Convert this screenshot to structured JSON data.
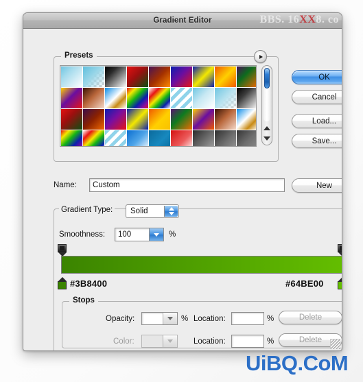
{
  "window": {
    "title": "Gradient Editor",
    "watermark_top_prefix": "BBS. 16",
    "watermark_top_red": "XX",
    "watermark_top_suffix": "8. co",
    "watermark_bottom": "UiBQ.CoM"
  },
  "presets": {
    "legend": "Presets",
    "options_icon": "options-triangle-icon",
    "scrollbar": {
      "up_icon": "triangle-up-icon",
      "down_icon": "triangle-down-icon"
    },
    "swatches": [
      {
        "name": "transparent-blue",
        "css": "linear-gradient(135deg,#6fc6e2 0%,#a9dced 35%,#ffffff 100%)"
      },
      {
        "name": "blue-to-checker",
        "css": "linear-gradient(135deg,#5fbfdd 0%,#9ad6e8 45%,rgba(255,255,255,0) 100%)"
      },
      {
        "name": "black-white",
        "css": "linear-gradient(135deg,#000000 0%,#2b2b2b 30%,#ffffff 100%)"
      },
      {
        "name": "red-green",
        "css": "linear-gradient(135deg,#e41212 0%,#9c0f0f 45%,#0b4f12 100%)"
      },
      {
        "name": "violet-orange",
        "css": "linear-gradient(135deg,#4a1455 0%,#a33000 50%,#ff8a00 100%)"
      },
      {
        "name": "blue-red",
        "css": "linear-gradient(135deg,#0b1fae 0%,#6a0ea0 45%,#e81414 100%)"
      },
      {
        "name": "blue-yellow-blue",
        "css": "linear-gradient(135deg,#0b1fae 0%,#f3e800 50%,#0b1fae 100%)"
      },
      {
        "name": "orange-yellow",
        "css": "linear-gradient(135deg,#f05a00 0%,#ffd000 50%,#f05a00 100%)"
      },
      {
        "name": "violet-green-orange",
        "css": "linear-gradient(135deg,#4a1455 0%,#0d6b1e 40%,#f26a00 100%)"
      },
      {
        "name": "yellow-violet-red",
        "css": "linear-gradient(135deg,#ffd000 0%,#6a0ea0 45%,#e81414 100%)"
      },
      {
        "name": "copper",
        "css": "linear-gradient(135deg,#3a1406 0%,#b9663a 45%,#f4d8c8 100%)"
      },
      {
        "name": "blue-gold-white",
        "css": "linear-gradient(135deg,#0b8ce8 0%,#ffffff 48%,#c88a14 70%,#ffffff 100%)"
      },
      {
        "name": "spectrum",
        "css": "linear-gradient(135deg,#e81414 0%,#f3e800 22%,#16b415 44%,#0b1fae 66%,#8a0ea0 85%,#e81414 100%)"
      },
      {
        "name": "transparent-rainbow",
        "css": "linear-gradient(135deg,#ffffff 0%,#e81414 25%,#f3e800 45%,#16b415 62%,#0b1fae 80%,#ffffff 100%)"
      },
      {
        "name": "blue-stripes",
        "css": "repeating-linear-gradient(135deg,#8fd3ea 0 5px,#ffffff 5px 10px)"
      },
      {
        "name": "pale-blue-white",
        "css": "linear-gradient(135deg,#6fc6e2 0%,#c7e8f3 45%,#ffffff 100%)"
      },
      {
        "name": "blue-checker",
        "css": "linear-gradient(135deg,#6fc6e2 0%,#b8e2ef 50%,rgba(255,255,255,0) 100%)"
      },
      {
        "name": "black-white-2",
        "css": "linear-gradient(135deg,#000000 0%,#3c3c3c 35%,#ffffff 100%)"
      },
      {
        "name": "red-dark-green",
        "css": "linear-gradient(135deg,#e41212 0%,#9c0f0f 40%,#0b4f12 100%)"
      },
      {
        "name": "purple-orange",
        "css": "linear-gradient(135deg,#3a0d4a 0%,#8c2200 50%,#f26a00 100%)"
      },
      {
        "name": "blue-red-2",
        "css": "linear-gradient(135deg,#0b1fae 0%,#7a0ea0 45%,#e81414 100%)"
      },
      {
        "name": "blue-yellow-blue-2",
        "css": "linear-gradient(135deg,#0b1fae 0%,#f3e800 50%,#0b1fae 100%)"
      },
      {
        "name": "orange-yellow-2",
        "css": "linear-gradient(135deg,#f05a00 0%,#ffd000 55%,#f8c100 100%)"
      },
      {
        "name": "violet-green-orange-2",
        "css": "linear-gradient(135deg,#5a1470 0%,#0d7b20 42%,#f26a00 100%)"
      },
      {
        "name": "yellow-violet-red-2",
        "css": "linear-gradient(135deg,#ffd000 0%,#6a0ea0 48%,#f05a00 100%)"
      },
      {
        "name": "copper-2",
        "css": "linear-gradient(135deg,#3a1406 0%,#b9663a 45%,#f4d8c8 100%)"
      },
      {
        "name": "blue-gold-white-2",
        "css": "linear-gradient(135deg,#0b8ce8 0%,#ffffff 45%,#c88a14 72%,#ffffff 100%)"
      },
      {
        "name": "spectrum-2",
        "css": "linear-gradient(135deg,#e81414 0%,#f3e800 20%,#16b415 42%,#0b1fae 66%,#8a0ea0 88%,#e81414 100%)"
      },
      {
        "name": "transparent-rainbow-2",
        "css": "linear-gradient(135deg,#ffffff 0%,#e81414 22%,#f3e800 42%,#16b415 60%,#0b1fae 82%,#ffffff 100%)"
      },
      {
        "name": "blue-stripes-2",
        "css": "repeating-linear-gradient(135deg,#8fd3ea 0 5px,#ffffff 5px 10px)"
      },
      {
        "name": "blue-to-white",
        "css": "linear-gradient(135deg,#0b6fd0 0%,#4fa5e8 50%,#ffffff 100%)"
      },
      {
        "name": "steel-blue",
        "css": "linear-gradient(135deg,#0b6a9c 0%,#1788be 55%,#0b6a9c 100%)"
      },
      {
        "name": "red-to-white",
        "css": "linear-gradient(135deg,#d41212 0%,#ec5a5a 55%,#ffffff 100%)"
      },
      {
        "name": "gray-gradient",
        "css": "linear-gradient(135deg,#2c2c2c 0%,#6a6a6a 50%,#a8a8a8 100%)"
      },
      {
        "name": "gray-gradient-2",
        "css": "linear-gradient(135deg,#303030 0%,#707070 55%,#9a9a9a 100%)"
      },
      {
        "name": "gray-gradient-3",
        "css": "linear-gradient(135deg,#353535 0%,#6d6d6d 50%,#8f8f8f 100%)"
      }
    ]
  },
  "buttons": {
    "ok": "OK",
    "cancel": "Cancel",
    "load": "Load...",
    "save": "Save...",
    "new": "New",
    "delete_1": "Delete",
    "delete_2": "Delete"
  },
  "name_row": {
    "label": "Name:",
    "value": "Custom"
  },
  "gradient_type": {
    "label": "Gradient Type:",
    "value": "Solid",
    "stepper_icon": "stepper-updown-icon"
  },
  "smoothness": {
    "label": "Smoothness:",
    "value": "100",
    "percent": "%",
    "dropdown_icon": "chevron-down-icon"
  },
  "gradient": {
    "start_hex": "#3B8400",
    "end_hex": "#64BE00",
    "css": "linear-gradient(to right,#3B8400 0%,#4e9e00 45%,#64BE00 100%)",
    "opacity_stop_left_name": "opacity-stop-left",
    "opacity_stop_right_name": "opacity-stop-right",
    "color_stop_left_name": "color-stop-left",
    "color_stop_right_name": "color-stop-right"
  },
  "stops": {
    "legend": "Stops",
    "opacity_label": "Opacity:",
    "opacity_value": "",
    "opacity_percent": "%",
    "location_label_1": "Location:",
    "location_value_1": "",
    "location_percent_1": "%",
    "color_label": "Color:",
    "color_value": "",
    "location_label_2": "Location:",
    "location_value_2": "",
    "location_percent_2": "%"
  }
}
